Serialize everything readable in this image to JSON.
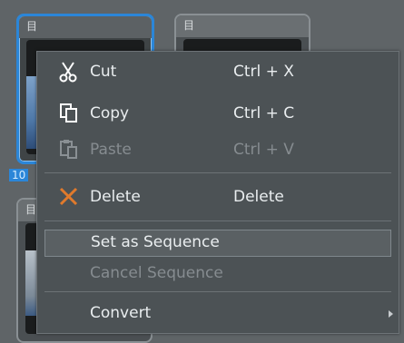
{
  "thumbnails": {
    "selected_number": "10",
    "film_glyph": "目"
  },
  "menu": {
    "items": [
      {
        "label": "Cut",
        "shortcut": "Ctrl + X",
        "icon": "scissors-icon",
        "enabled": true
      },
      {
        "label": "Copy",
        "shortcut": "Ctrl + C",
        "icon": "copy-icon",
        "enabled": true
      },
      {
        "label": "Paste",
        "shortcut": "Ctrl + V",
        "icon": "paste-icon",
        "enabled": false
      },
      {
        "label": "Delete",
        "shortcut": "Delete",
        "icon": "delete-x-icon",
        "enabled": true
      },
      {
        "label": "Set as Sequence",
        "shortcut": "",
        "enabled": true,
        "highlighted": true
      },
      {
        "label": "Cancel Sequence",
        "shortcut": "",
        "enabled": false
      },
      {
        "label": "Convert",
        "shortcut": "",
        "enabled": true,
        "submenu": true
      }
    ]
  },
  "colors": {
    "selection_border": "#2b86d8",
    "delete_icon": "#e07a2c"
  }
}
